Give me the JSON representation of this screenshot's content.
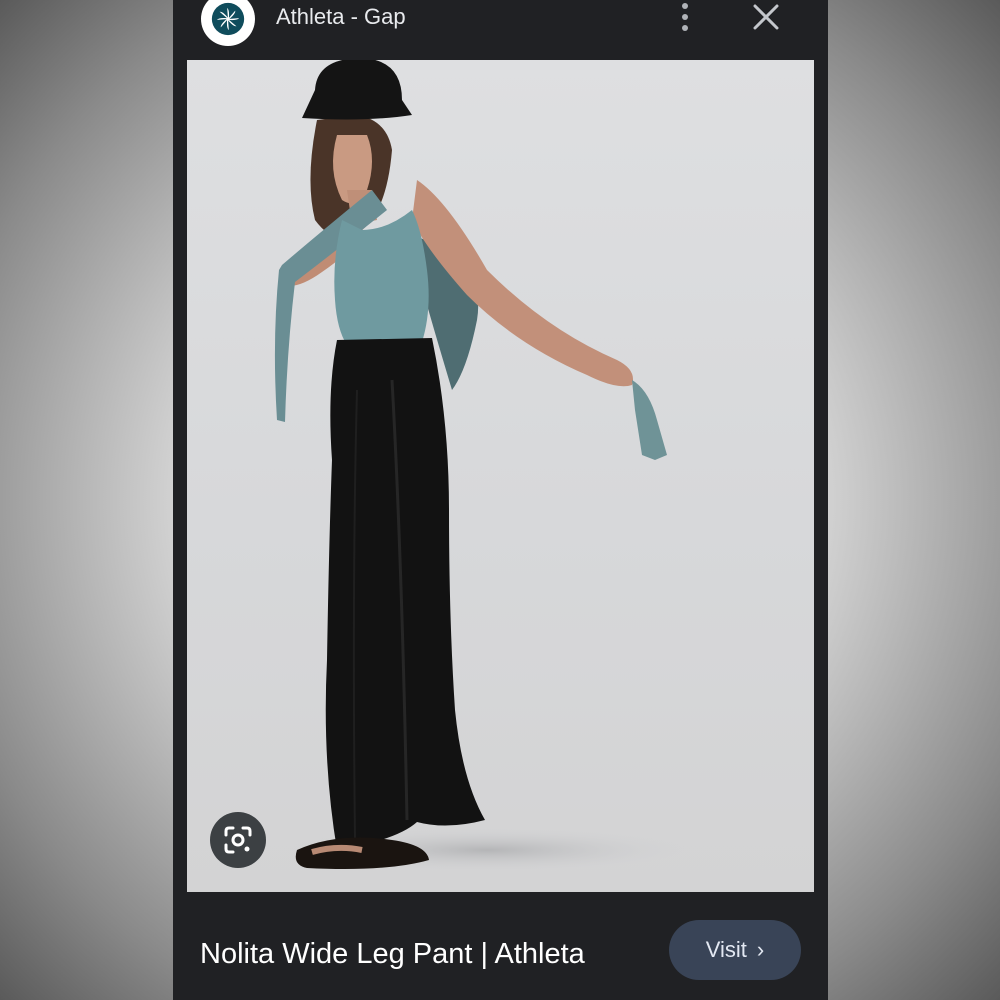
{
  "header": {
    "site_name": "Athleta - Gap",
    "logo_icon": "athleta-pinwheel-logo",
    "more_icon": "more-vert-icon",
    "close_icon": "close-icon"
  },
  "image": {
    "lens_icon": "google-lens-icon"
  },
  "footer": {
    "title": "Nolita Wide Leg Pant | Athleta",
    "visit_label": "Visit",
    "visit_icon": "chevron-right-icon"
  },
  "colors": {
    "panel": "#202124",
    "visit_button": "#394457",
    "logo_teal": "#0f4c5c"
  }
}
